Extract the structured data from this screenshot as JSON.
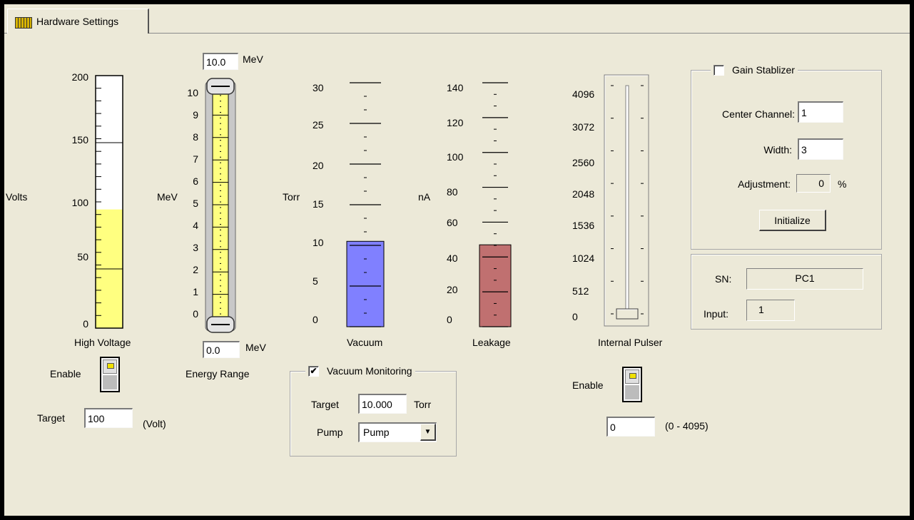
{
  "tab": {
    "label": "Hardware Settings",
    "icon": "meter-panel-icon"
  },
  "high_voltage": {
    "ticks": [
      "200",
      "150",
      "100",
      "50",
      "0"
    ],
    "axis_label": "Volts",
    "title": "High Voltage",
    "enable_label": "Enable",
    "target_label": "Target",
    "target_value": "100",
    "unit_label": "(Volt)",
    "level_fraction": 0.47,
    "fill_color": "#ffff80"
  },
  "energy_range": {
    "max_value": "10.0",
    "max_unit": "MeV",
    "ticks": [
      "10",
      "9",
      "8",
      "7",
      "6",
      "5",
      "4",
      "3",
      "2",
      "1",
      "0"
    ],
    "axis_label": "MeV",
    "min_value": "0.0",
    "min_unit": "MeV",
    "title": "Energy Range",
    "fill_color": "#ffff80"
  },
  "vacuum": {
    "ticks": [
      "30",
      "25",
      "20",
      "15",
      "10",
      "5",
      "0"
    ],
    "axis_label": "Torr",
    "title": "Vacuum",
    "level_value": 10.5,
    "max_value": 30,
    "fill_color": "#8080ff"
  },
  "leakage": {
    "ticks": [
      "140",
      "120",
      "100",
      "80",
      "60",
      "40",
      "20",
      "0"
    ],
    "axis_label": "nA",
    "title": "Leakage",
    "level_value": 47,
    "max_value": 140,
    "fill_color": "#c07070"
  },
  "vacuum_monitoring": {
    "checked": true,
    "check_mark": "✔",
    "title": "Vacuum Monitoring",
    "target_label": "Target",
    "target_value": "10.000",
    "target_unit": "Torr",
    "pump_label": "Pump",
    "pump_selected": "Pump",
    "dropdown_arrow": "▼"
  },
  "internal_pulser": {
    "ticks": [
      "4096",
      "3072",
      "2560",
      "2048",
      "1536",
      "1024",
      "512",
      "0"
    ],
    "title": "Internal Pulser",
    "enable_label": "Enable",
    "value": "0",
    "range_label": "(0 - 4095)",
    "slider_value": 0
  },
  "gain_stabilizer": {
    "checked": false,
    "title": "Gain Stablizer",
    "center_channel_label": "Center Channel:",
    "center_channel_value": "1",
    "width_label": "Width:",
    "width_value": "3",
    "adjustment_label": "Adjustment:",
    "adjustment_value": "0",
    "adjustment_unit": "%",
    "initialize_label": "Initialize"
  },
  "device_info": {
    "sn_label": "SN:",
    "sn_value": "PC1",
    "input_label": "Input:",
    "input_value": "1"
  }
}
